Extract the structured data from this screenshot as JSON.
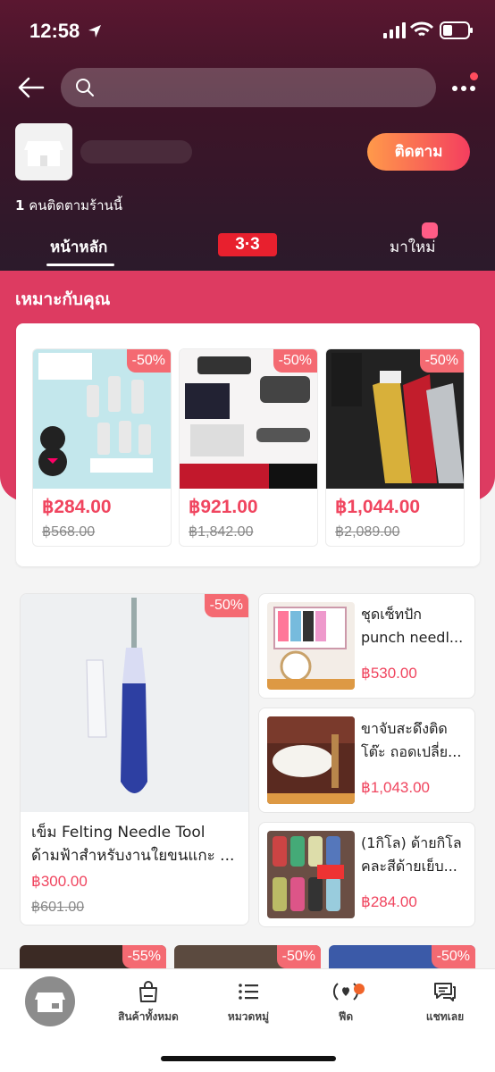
{
  "status_bar": {
    "time": "12:58"
  },
  "search": {
    "placeholder": ""
  },
  "shop": {
    "follow_label": "ติดตาม",
    "followers_count": "1",
    "followers_text": " คนติดตามร้านนี้"
  },
  "tabs": {
    "home": "หน้าหลัก",
    "promo": "3·3",
    "new": "มาใหม่"
  },
  "for_you": {
    "title": "เหมาะกับคุณ",
    "items": [
      {
        "discount": "-50%",
        "price": "฿284.00",
        "old_price": "฿568.00"
      },
      {
        "discount": "-50%",
        "price": "฿921.00",
        "old_price": "฿1,842.00"
      },
      {
        "discount": "-50%",
        "price": "฿1,044.00",
        "old_price": "฿2,089.00"
      }
    ]
  },
  "featured": {
    "discount": "-50%",
    "title_line1": "เข็ม Felting Needle Tool",
    "title_line2": "ด้ามฟ้าสำหรับงานใยขนแกะ ...",
    "price": "฿300.00",
    "old_price": "฿601.00"
  },
  "side_products": [
    {
      "line1": "ชุดเซ็ทปัก",
      "line2": "punch needl...",
      "price": "฿530.00"
    },
    {
      "line1": "ขาจับสะดึงติด",
      "line2": "โต๊ะ ถอดเปลี่ย...",
      "price": "฿1,043.00"
    },
    {
      "line1": "(1กิโล) ด้ายกิโล",
      "line2": "คละสีด้ายเย็บ...",
      "price": "฿284.00"
    }
  ],
  "row3_discounts": [
    "-55%",
    "-50%",
    "-50%"
  ],
  "bottom_nav": {
    "all_products": "สินค้าทั้งหมด",
    "categories": "หมวดหมู่",
    "feed": "ฟีด",
    "chat": "แชทเลย"
  }
}
